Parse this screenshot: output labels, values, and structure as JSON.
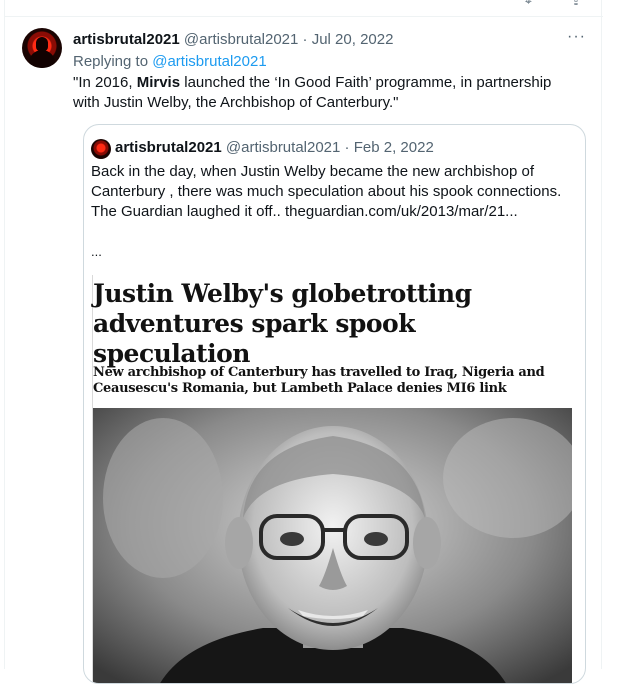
{
  "tweet": {
    "username": "artisbrutal2021",
    "handle": "@artisbrutal2021",
    "separator": "·",
    "date": "Jul 20, 2022",
    "more_icon": "more-horizontal-icon",
    "more_label": "···",
    "replying_to_label": "Replying to",
    "replying_to_handle": "@artisbrutal2021",
    "text_part1": "\"In 2016, ",
    "text_bold": "Mirvis",
    "text_part2": " launched the ‘In Good Faith’ programme, in partnership with Justin Welby, the Archbishop of Canterbury.\""
  },
  "quote": {
    "username": "artisbrutal2021",
    "handle": "@artisbrutal2021",
    "separator": "·",
    "date": "Feb 2, 2022",
    "text": "Back in the day, when Justin Welby became the new archbishop of Canterbury , there was much speculation about his spook connections.  The Guardian laughed it off.. theguardian.com/uk/2013/mar/21...",
    "ellipsis": "...",
    "article": {
      "headline": "Justin Welby's globetrotting adventures spark spook speculation",
      "standfirst": "New archbishop of Canterbury has travelled to Iraq, Nigeria and Ceausescu's Romania, but Lambeth Palace denies MI6 link"
    }
  },
  "colors": {
    "link": "#1d9bf0",
    "secondary_text": "#536471",
    "border": "#cfd9de"
  }
}
